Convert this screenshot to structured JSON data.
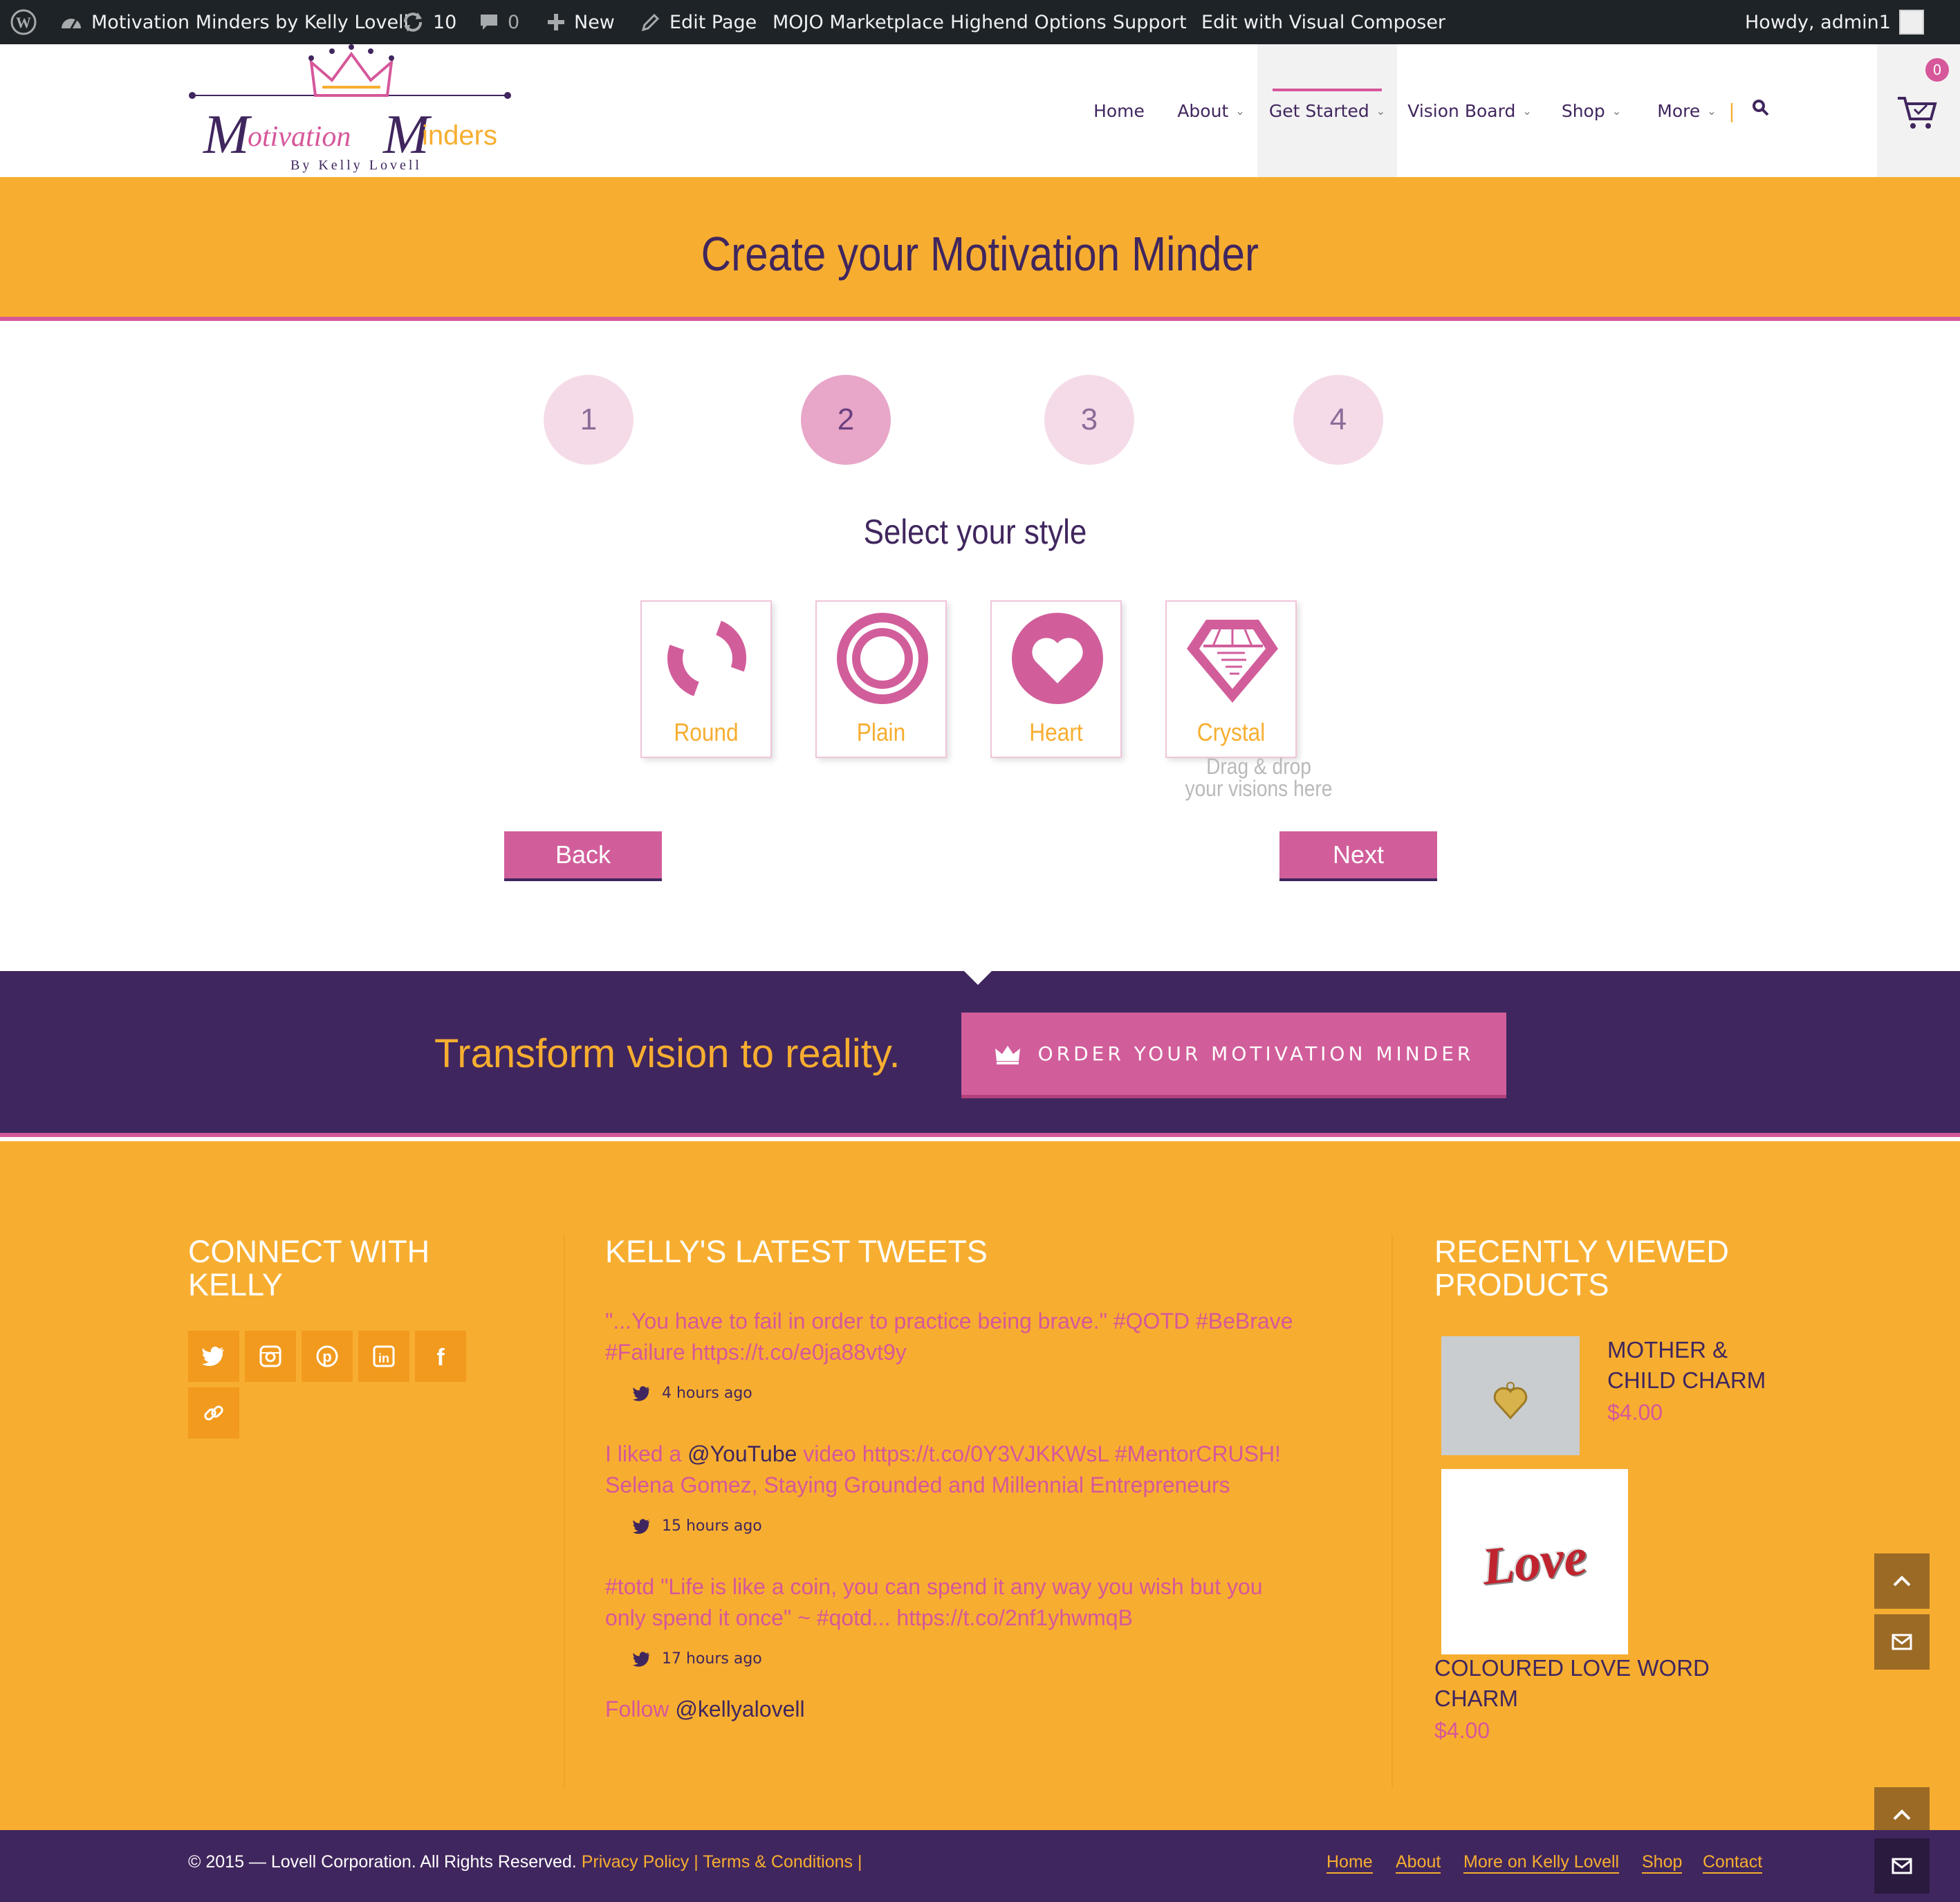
{
  "admin_bar": {
    "site_name": "Motivation Minders by Kelly Lovell",
    "updates_count": "10",
    "comments_count": "0",
    "new_label": "New",
    "edit_page_label": "Edit Page",
    "mojo_label": "MOJO Marketplace",
    "highend_label": "Highend Options",
    "support_label": "Support",
    "visual_composer_label": "Edit with Visual Composer",
    "howdy_label": "Howdy, admin1"
  },
  "logo": {
    "line1_a": "otivation",
    "line1_b": "inders",
    "letter_m": "M",
    "byline": "By Kelly Lovell"
  },
  "nav": {
    "items": [
      {
        "label": "Home"
      },
      {
        "label": "About"
      },
      {
        "label": "Get Started"
      },
      {
        "label": "Vision Board"
      },
      {
        "label": "Shop"
      },
      {
        "label": "More"
      }
    ],
    "separator": "|",
    "cart_count": "0"
  },
  "page_title": "Create your Motivation Minder",
  "steps": [
    "1",
    "2",
    "3",
    "4"
  ],
  "active_step": 2,
  "style_heading": "Select your style",
  "styles": [
    {
      "label": "Round"
    },
    {
      "label": "Plain"
    },
    {
      "label": "Heart"
    },
    {
      "label": "Crystal"
    }
  ],
  "drag_drop_line1": "Drag & drop",
  "drag_drop_line2": "your visions here",
  "back_label": "Back",
  "next_label": "Next",
  "promo": {
    "text": "Transform vision to reality.",
    "button_label": "ORDER YOUR MOTIVATION MINDER"
  },
  "footer": {
    "connect_heading_1": "CONNECT WITH",
    "connect_heading_2": "KELLY",
    "tweets_heading": "KELLY'S LATEST TWEETS",
    "tweets": [
      {
        "line1": "\"...You have to fail in order to practice being brave.\" #QOTD #BeBrave",
        "line2": "#Failure https://t.co/e0ja88vt9y",
        "time": "4 hours ago"
      },
      {
        "pre": "I liked a",
        "mention": "@YouTube",
        "line1_rest": "video https://t.co/0Y3VJKKWsL #MentorCRUSH!",
        "line2": "Selena Gomez, Staying Grounded and Millennial Entrepreneurs",
        "time": "15 hours ago"
      },
      {
        "line1": "#totd \"Life is like a coin, you can spend it any way you wish but you",
        "line2": "only spend it once\" ~ #qotd... https://t.co/2nf1yhwmqB",
        "time": "17 hours ago"
      }
    ],
    "follow_label": "Follow",
    "follow_handle": "@kellyalovell",
    "recent_heading_1": "RECENTLY VIEWED",
    "recent_heading_2": "PRODUCTS",
    "products": [
      {
        "name_1": "MOTHER &",
        "name_2": "CHILD CHARM",
        "price": "$4.00"
      },
      {
        "name_1": "COLOURED LOVE WORD",
        "name_2": "CHARM",
        "price": "$4.00",
        "image_text": "Love"
      }
    ]
  },
  "bottom": {
    "copyright": "© 2015 — Lovell Corporation. All Rights Reserved.",
    "privacy": "Privacy Policy",
    "terms": "Terms & Conditions",
    "sep": "|",
    "links": [
      "Home",
      "About",
      "More on Kelly Lovell",
      "Shop",
      "Contact"
    ]
  },
  "colors": {
    "orange": "#f7ae30",
    "purple": "#40265e",
    "pink": "#d6579a"
  }
}
